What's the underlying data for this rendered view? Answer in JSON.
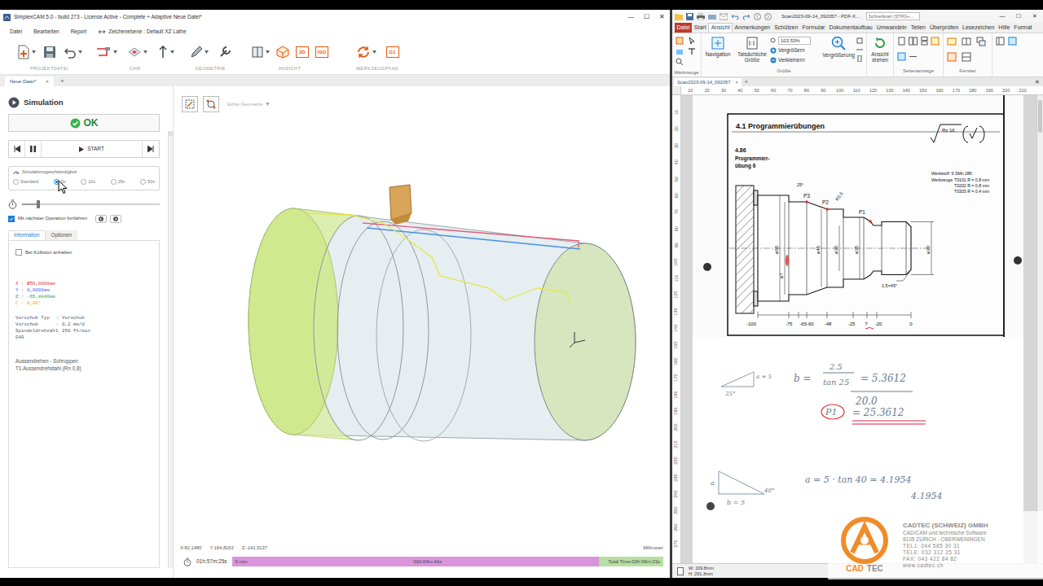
{
  "cam": {
    "title": "SimplexCAM 5.0 - build 273 - License Active - Complete + Adaptive Neue Datei*",
    "controls": [
      "—",
      "☐",
      "✕"
    ],
    "menu": [
      "Datei",
      "Bearbeiten",
      "Report"
    ],
    "plane": "Zeichenebene : Default XZ Lathe",
    "toolbar_groups": [
      "PROJEKTDATEI",
      "CAM",
      "GEOMETRIE",
      "ANSICHT",
      "WERKZEUGPFAD"
    ],
    "toolbar_badges": [
      "2D",
      "ISO",
      "G1"
    ],
    "doc_tab": {
      "label": "Neue Datei*",
      "close": "×",
      "selected": true
    },
    "add_tab": "+"
  },
  "sim": {
    "title": "Simulation",
    "ok": "OK",
    "start": "START",
    "speed_label": "Simulationsgeschwindigkeit",
    "speeds": [
      {
        "label": "Standard",
        "selected": false
      },
      {
        "label": "5x",
        "selected": true
      },
      {
        "label": "10x",
        "selected": false
      },
      {
        "label": "25x",
        "selected": false
      },
      {
        "label": "50x",
        "selected": false
      }
    ],
    "slider_level": 0.12,
    "continue": {
      "label": "Mit nächster Operation fortfahren",
      "checked": true
    },
    "tabs": [
      {
        "label": "Information",
        "selected": true
      },
      {
        "label": "Optionen",
        "selected": false
      }
    ],
    "collision": {
      "label": "Bei Kollision anhalten",
      "checked": false
    },
    "coords": [
      {
        "text": "X : Ø50,0000mm",
        "color": "#e03131"
      },
      {
        "text": "Y : 0,0000mm",
        "color": "#4263eb"
      },
      {
        "text": "Z : -65,8840mm",
        "color": "#2f9e44"
      },
      {
        "text": "C : 0,00°",
        "color": "#f59f00"
      }
    ],
    "params": [
      {
        "key": "Vorschub Typ",
        "value": ": Vorschub"
      },
      {
        "key": "Vorschub",
        "value": ": 0,2 mm/U"
      },
      {
        "key": "Spindeldrehzahl",
        "value": ": 250 ft/min"
      }
    ],
    "gcode": "G40",
    "operation": "Aussendrehen - Schruppen",
    "tool": "T1.Aussendrehstahl (Rn 0,8)"
  },
  "viewport": {
    "geometry": "Echte Geometrie",
    "coords": [
      "X:82,1480",
      "Y:164,8163",
      "Z:-141,5137"
    ],
    "units": "Millimeter"
  },
  "timeline": {
    "elapsed": "01h:57m:25s",
    "start": "0 min",
    "middle": "01h:04m:41s",
    "total": "Total Time:02h:09m:23s",
    "level": 0.85
  },
  "pdf": {
    "title": "Scan2023-09-14_092057 - PDF-X...",
    "search": "Schnellstart (STRG+...",
    "controls": [
      "—",
      "☐",
      "✕"
    ],
    "tabs": [
      {
        "label": "Datei",
        "selected": false,
        "kind": "file"
      },
      {
        "label": "Start",
        "selected": false,
        "kind": "tab"
      },
      {
        "label": "Ansicht",
        "selected": true,
        "kind": "tab"
      },
      {
        "label": "Anmerkungen",
        "selected": false,
        "kind": "tab"
      },
      {
        "label": "Schützen",
        "selected": false,
        "kind": "tab"
      },
      {
        "label": "Formular",
        "selected": false,
        "kind": "tab"
      },
      {
        "label": "Dokumentaufbau",
        "selected": false,
        "kind": "tab"
      },
      {
        "label": "Umwandeln",
        "selected": false,
        "kind": "tab"
      },
      {
        "label": "Teilen",
        "selected": false,
        "kind": "tab"
      },
      {
        "label": "Überprüfen",
        "selected": false,
        "kind": "tab"
      },
      {
        "label": "Lesezeichen",
        "selected": false,
        "kind": "tab"
      },
      {
        "label": "Hilfe",
        "selected": false,
        "kind": "tab"
      },
      {
        "label": "Format",
        "selected": false,
        "kind": "tab"
      }
    ],
    "ribbon": {
      "navigation": "Navigation",
      "actual": "Tatsächliche Größe",
      "zoom": "103.53%",
      "zoom_in": "Vergrößern",
      "zoom_out": "Verkleinern",
      "magnify": "Vergrößerung",
      "rotate": "Ansicht drehen",
      "groups": [
        "Werkzeuge",
        "Größe",
        "Seitenanzeige",
        "Fenster"
      ]
    },
    "doc_tab": {
      "label": "Scan2023-09-14_092057",
      "close": "×",
      "selected": true
    },
    "add_tab": "+",
    "close": "✕",
    "ruler_top": [
      "10",
      "20",
      "30",
      "40",
      "50",
      "60",
      "70",
      "80",
      "90",
      "100",
      "110",
      "120",
      "130",
      "140",
      "150",
      "160",
      "170",
      "180",
      "190",
      "200",
      "210"
    ],
    "ruler_left": [
      "10",
      "20",
      "30",
      "40",
      "50",
      "60",
      "70",
      "80",
      "90",
      "100",
      "110",
      "120",
      "130",
      "140",
      "150",
      "160",
      "170",
      "180",
      "190",
      "200",
      "210",
      "220",
      "230",
      "240",
      "250",
      "260",
      "270"
    ],
    "sheet": {
      "heading": "4.1 Programmierübungen",
      "exercise_no": "4.86",
      "exercise_title": [
        "Programmier-",
        "übung 6"
      ],
      "surface": "Rz 16",
      "material": "Werkstoff: 9 SMn 28K",
      "tools_label": "Werkzeuge",
      "tools": [
        "T0101  R = 0,8 mm",
        "T0202  R = 0,8 mm",
        "T0303  R = 0,4 mm"
      ],
      "points": [
        "P1",
        "P2",
        "P3"
      ],
      "dims_x": [
        "-100",
        "-75",
        "-65-60",
        "-48",
        "-25",
        "?",
        "-20",
        "0"
      ],
      "dims_d": [
        "ø60",
        "ø?",
        "ø45",
        "ø30",
        "ø35",
        "ø30"
      ],
      "other": [
        "R2,5",
        "25°",
        "1,5×45°"
      ]
    },
    "notes": {
      "angle1": "25°",
      "side1": "a = 5",
      "b_lhs": "b =",
      "b_num": "2.5",
      "b_den": "tan 25",
      "b_eq": "= 5.3612",
      "b_sum": "20.0",
      "p1": "P1",
      "p1_val": "= 25.3612",
      "side2a": "a",
      "angle2": "40°",
      "side2": "b = 5",
      "a_eq": "a = 5 · tan 40 = 4.1954",
      "a_copy": "4.1954"
    },
    "status": [
      "W: 209.8mm",
      "H: 291.3mm"
    ]
  },
  "watermark": {
    "logo": [
      "CAD",
      "TEC"
    ],
    "name": "CADTEC (SCHWEIZ) GMBH",
    "tagline": "CAD/CAM und technische Software",
    "address": "8105 ZÜRICH - OBERWENINGEN",
    "lines": [
      "TEL1: 044 585 30 31",
      "TELE: 032 312 25 31",
      "FAX: 043 422 84 82",
      "www.cadtec.ch"
    ]
  }
}
